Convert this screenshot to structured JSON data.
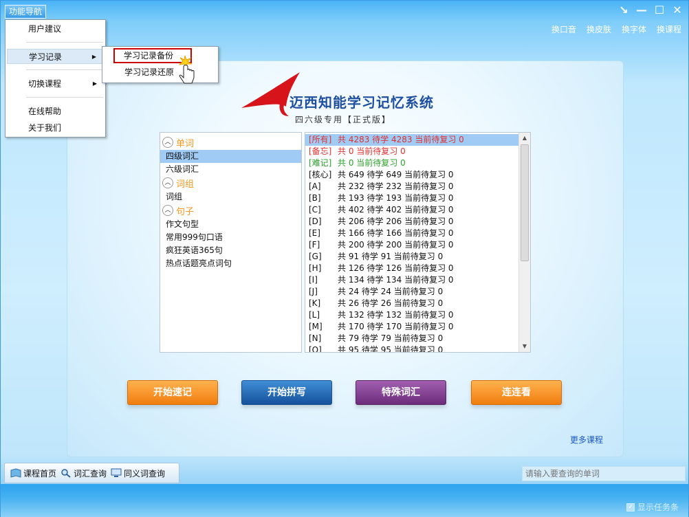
{
  "window": {
    "nav_button": "功能导航",
    "controls": [
      "↘",
      "—",
      "☐",
      "✕"
    ],
    "top_links": [
      "换口音",
      "换皮肤",
      "换字体",
      "换课程"
    ]
  },
  "logo": {
    "title": "迈西知能学习记忆系统",
    "subtitle": "四六级专用【正式版】"
  },
  "left_list": {
    "groups": [
      {
        "label": "单词",
        "items": [
          "四级词汇",
          "六级词汇"
        ]
      },
      {
        "label": "词组",
        "items": [
          "词组"
        ]
      },
      {
        "label": "句子",
        "items": [
          "作文句型",
          "常用999句口语",
          "疯狂英语365句",
          "热点话题亮点词句"
        ]
      }
    ],
    "selected": "四级词汇"
  },
  "right_list": {
    "rows": [
      {
        "tag": "[所有]",
        "text": "共 4283 待学 4283 当前待复习 0",
        "color": "#e03030",
        "selected": true
      },
      {
        "tag": "[备忘]",
        "text": "共 0  当前待复习 0",
        "color": "#e03030"
      },
      {
        "tag": "[难记]",
        "text": "共 0  当前待复习 0",
        "color": "#2aa02a"
      },
      {
        "tag": "[核心]",
        "text": "共 649 待学 649 当前待复习 0",
        "color": "#111111"
      },
      {
        "tag": "[A]",
        "text": "共 232 待学 232 当前待复习 0",
        "color": "#111111"
      },
      {
        "tag": "[B]",
        "text": "共 193 待学 193 当前待复习 0",
        "color": "#111111"
      },
      {
        "tag": "[C]",
        "text": "共 402 待学 402 当前待复习 0",
        "color": "#111111"
      },
      {
        "tag": "[D]",
        "text": "共 206 待学 206 当前待复习 0",
        "color": "#111111"
      },
      {
        "tag": "[E]",
        "text": "共 166 待学 166 当前待复习 0",
        "color": "#111111"
      },
      {
        "tag": "[F]",
        "text": "共 200 待学 200 当前待复习 0",
        "color": "#111111"
      },
      {
        "tag": "[G]",
        "text": "共 91 待学 91 当前待复习 0",
        "color": "#111111"
      },
      {
        "tag": "[H]",
        "text": "共 126 待学 126 当前待复习 0",
        "color": "#111111"
      },
      {
        "tag": "[I]",
        "text": "共 134 待学 134 当前待复习 0",
        "color": "#111111"
      },
      {
        "tag": "[J]",
        "text": "共 24 待学 24 当前待复习 0",
        "color": "#111111"
      },
      {
        "tag": "[K]",
        "text": "共 26 待学 26 当前待复习 0",
        "color": "#111111"
      },
      {
        "tag": "[L]",
        "text": "共 132 待学 132 当前待复习 0",
        "color": "#111111"
      },
      {
        "tag": "[M]",
        "text": "共 170 待学 170 当前待复习 0",
        "color": "#111111"
      },
      {
        "tag": "[N]",
        "text": "共 79 待学 79 当前待复习 0",
        "color": "#111111"
      },
      {
        "tag": "[O]",
        "text": "共 95 待学 95 当前待复习 0",
        "color": "#111111"
      }
    ]
  },
  "actions": {
    "quick_memory": "开始速记",
    "spelling": "开始拼写",
    "special_vocab": "特殊词汇",
    "match_game": "连连看"
  },
  "more_courses": "更多课程",
  "bottom_tabs": [
    "课程首页",
    "词汇查询",
    "同义词查询"
  ],
  "search": {
    "placeholder": "请输入要查询的单词"
  },
  "status": {
    "show_taskbar": "显示任务条"
  },
  "menu": {
    "items": [
      "用户建议",
      "学习记录",
      "切换课程",
      "在线帮助",
      "关于我们"
    ],
    "submenu": [
      "学习记录备份",
      "学习记录还原"
    ]
  }
}
